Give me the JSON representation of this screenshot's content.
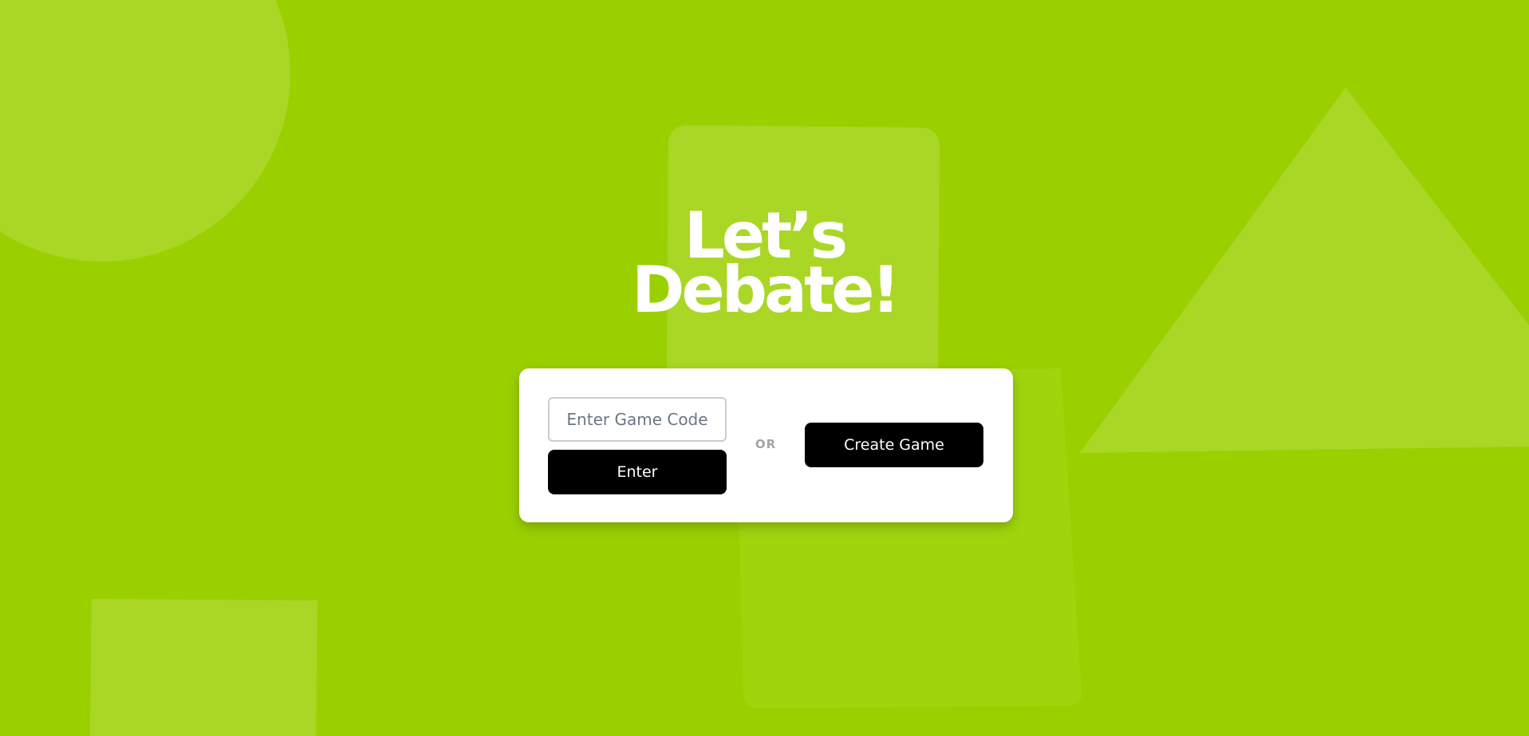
{
  "hero": {
    "title_line1": "Let’s",
    "title_line2": "Debate!"
  },
  "join": {
    "code_placeholder": "Enter Game Code",
    "code_value": "",
    "enter_label": "Enter"
  },
  "divider": {
    "label": "OR"
  },
  "create": {
    "label": "Create Game"
  },
  "colors": {
    "background": "#9bd000",
    "shape": "#aad726",
    "button": "#000000",
    "card": "#ffffff"
  }
}
